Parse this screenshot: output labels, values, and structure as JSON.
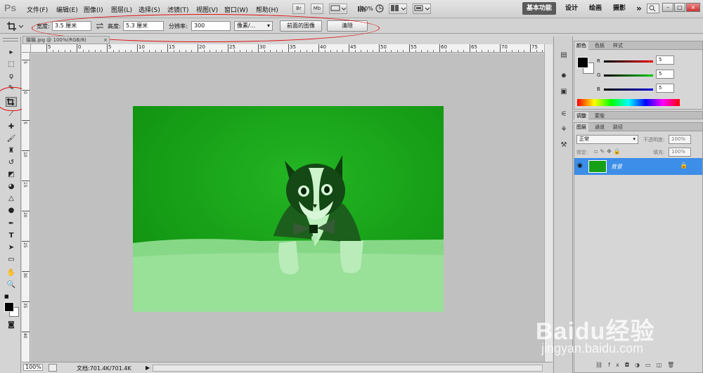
{
  "app": {
    "logo": "Ps"
  },
  "menu": [
    "文件(F)",
    "编辑(E)",
    "图像(I)",
    "图层(L)",
    "选择(S)",
    "滤镜(T)",
    "视图(V)",
    "窗口(W)",
    "帮助(H)"
  ],
  "menubar_tools": {
    "br": "Br",
    "mb": "Mb",
    "zoom": "100%"
  },
  "workspaces": {
    "active": "基本功能",
    "items": [
      "设计",
      "绘画",
      "摄影"
    ],
    "more": "»"
  },
  "window_buttons": {
    "min": "–",
    "restore": "□",
    "close": "×"
  },
  "options": {
    "width_label": "宽度:",
    "width_value": "3.5 厘米",
    "height_label": "高度:",
    "height_value": "5.3 厘米",
    "resolution_label": "分辨率:",
    "resolution_value": "300",
    "unit_value": "像素/...",
    "front_image_btn": "前面的图像",
    "clear_btn": "清除"
  },
  "document": {
    "tab_title": "猫猫.jpg @ 100%(RGB/8)",
    "tab_close": "×"
  },
  "ruler_top_labels": [
    "5",
    "0",
    "5",
    "10",
    "15",
    "20",
    "25",
    "30",
    "35",
    "40",
    "45",
    "50",
    "55",
    "60",
    "65",
    "70",
    "75"
  ],
  "ruler_left_labels": [
    "5",
    "0",
    "5",
    "10",
    "15",
    "20",
    "25",
    "30",
    "35",
    "40",
    "45"
  ],
  "status": {
    "zoom": "100%",
    "doc_info": "文档:701.4K/701.4K"
  },
  "color_panel": {
    "tabs": [
      "颜色",
      "色板",
      "样式"
    ],
    "r_label": "R",
    "g_label": "G",
    "b_label": "B",
    "r_value": "5",
    "g_value": "5",
    "b_value": "5"
  },
  "adjust_panel": {
    "tabs": [
      "调整",
      "蒙版"
    ]
  },
  "layers_panel": {
    "tabs": [
      "图层",
      "通道",
      "路径"
    ],
    "blend_mode": "正常",
    "opacity_label": "不透明度:",
    "opacity_value": "100%",
    "lock_label": "锁定:",
    "fill_label": "填充:",
    "fill_value": "100%",
    "layer_name": "背景"
  },
  "watermark": {
    "main": "Baidu经验",
    "sub": "jingyan.baidu.com"
  },
  "colors": {
    "accent_blue": "#3d8ee8",
    "annotation_red": "#e01010",
    "image_green": "#16a016"
  }
}
